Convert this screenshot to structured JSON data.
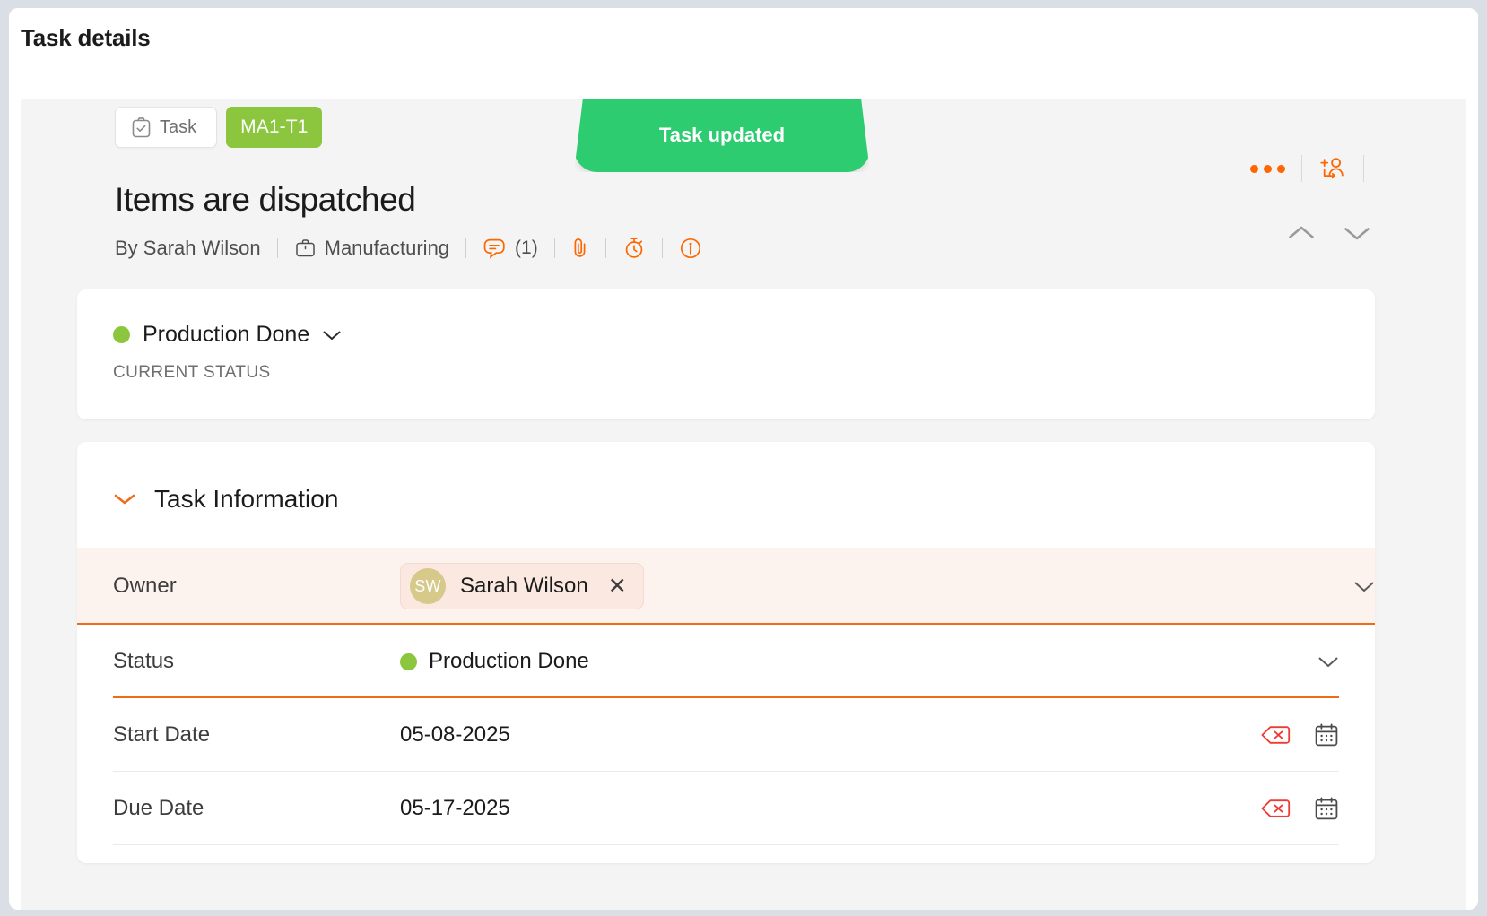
{
  "window": {
    "title": "Task details"
  },
  "header": {
    "module_chip": {
      "label": "Task",
      "icon": "clipboard-check-icon"
    },
    "code_chip": "MA1-T1",
    "task_title": "Items are dispatched",
    "meta": {
      "author": "By Sarah Wilson",
      "project": "Manufacturing",
      "project_icon": "briefcase-icon",
      "comments_icon": "comment-icon",
      "comments_count": "(1)",
      "attachment_icon": "paperclip-icon",
      "timer_icon": "stopwatch-icon",
      "info_icon": "info-icon"
    },
    "actions": {
      "more_icon": "more-options-icon",
      "assign_icon": "add-person-icon",
      "prev_icon": "chevron-up-icon",
      "next_icon": "chevron-down-icon"
    }
  },
  "toast": {
    "message": "Task updated",
    "color": "#2ecc71"
  },
  "status_card": {
    "status_label": "Production Done",
    "status_color": "#8cc63e",
    "caption": "CURRENT STATUS",
    "chevron_icon": "chevron-down-icon"
  },
  "task_information": {
    "section_title": "Task Information",
    "collapse_icon": "chevron-down-icon",
    "fields": [
      {
        "label": "Owner",
        "type": "person",
        "value": "Sarah Wilson",
        "avatar_initials": "SW",
        "avatar_color": "#d6c98a",
        "remove_icon": "close-icon",
        "dropdown_icon": "chevron-down-icon",
        "underline": "orange",
        "highlight": true
      },
      {
        "label": "Status",
        "type": "status",
        "value": "Production Done",
        "status_color": "#8cc63e",
        "dropdown_icon": "chevron-down-icon",
        "underline": "orange",
        "highlight": false
      },
      {
        "label": "Start Date",
        "type": "date",
        "value": "05-08-2025",
        "clear_icon": "backspace-delete-icon",
        "calendar_icon": "calendar-icon",
        "underline": "gray",
        "highlight": false
      },
      {
        "label": "Due Date",
        "type": "date",
        "value": "05-17-2025",
        "clear_icon": "backspace-delete-icon",
        "calendar_icon": "calendar-icon",
        "underline": "gray",
        "highlight": false
      }
    ]
  },
  "colors": {
    "accent": "#ff6600",
    "underline_active": "#ef6c16",
    "green": "#8cc63e",
    "toast_green": "#2ecc71"
  }
}
